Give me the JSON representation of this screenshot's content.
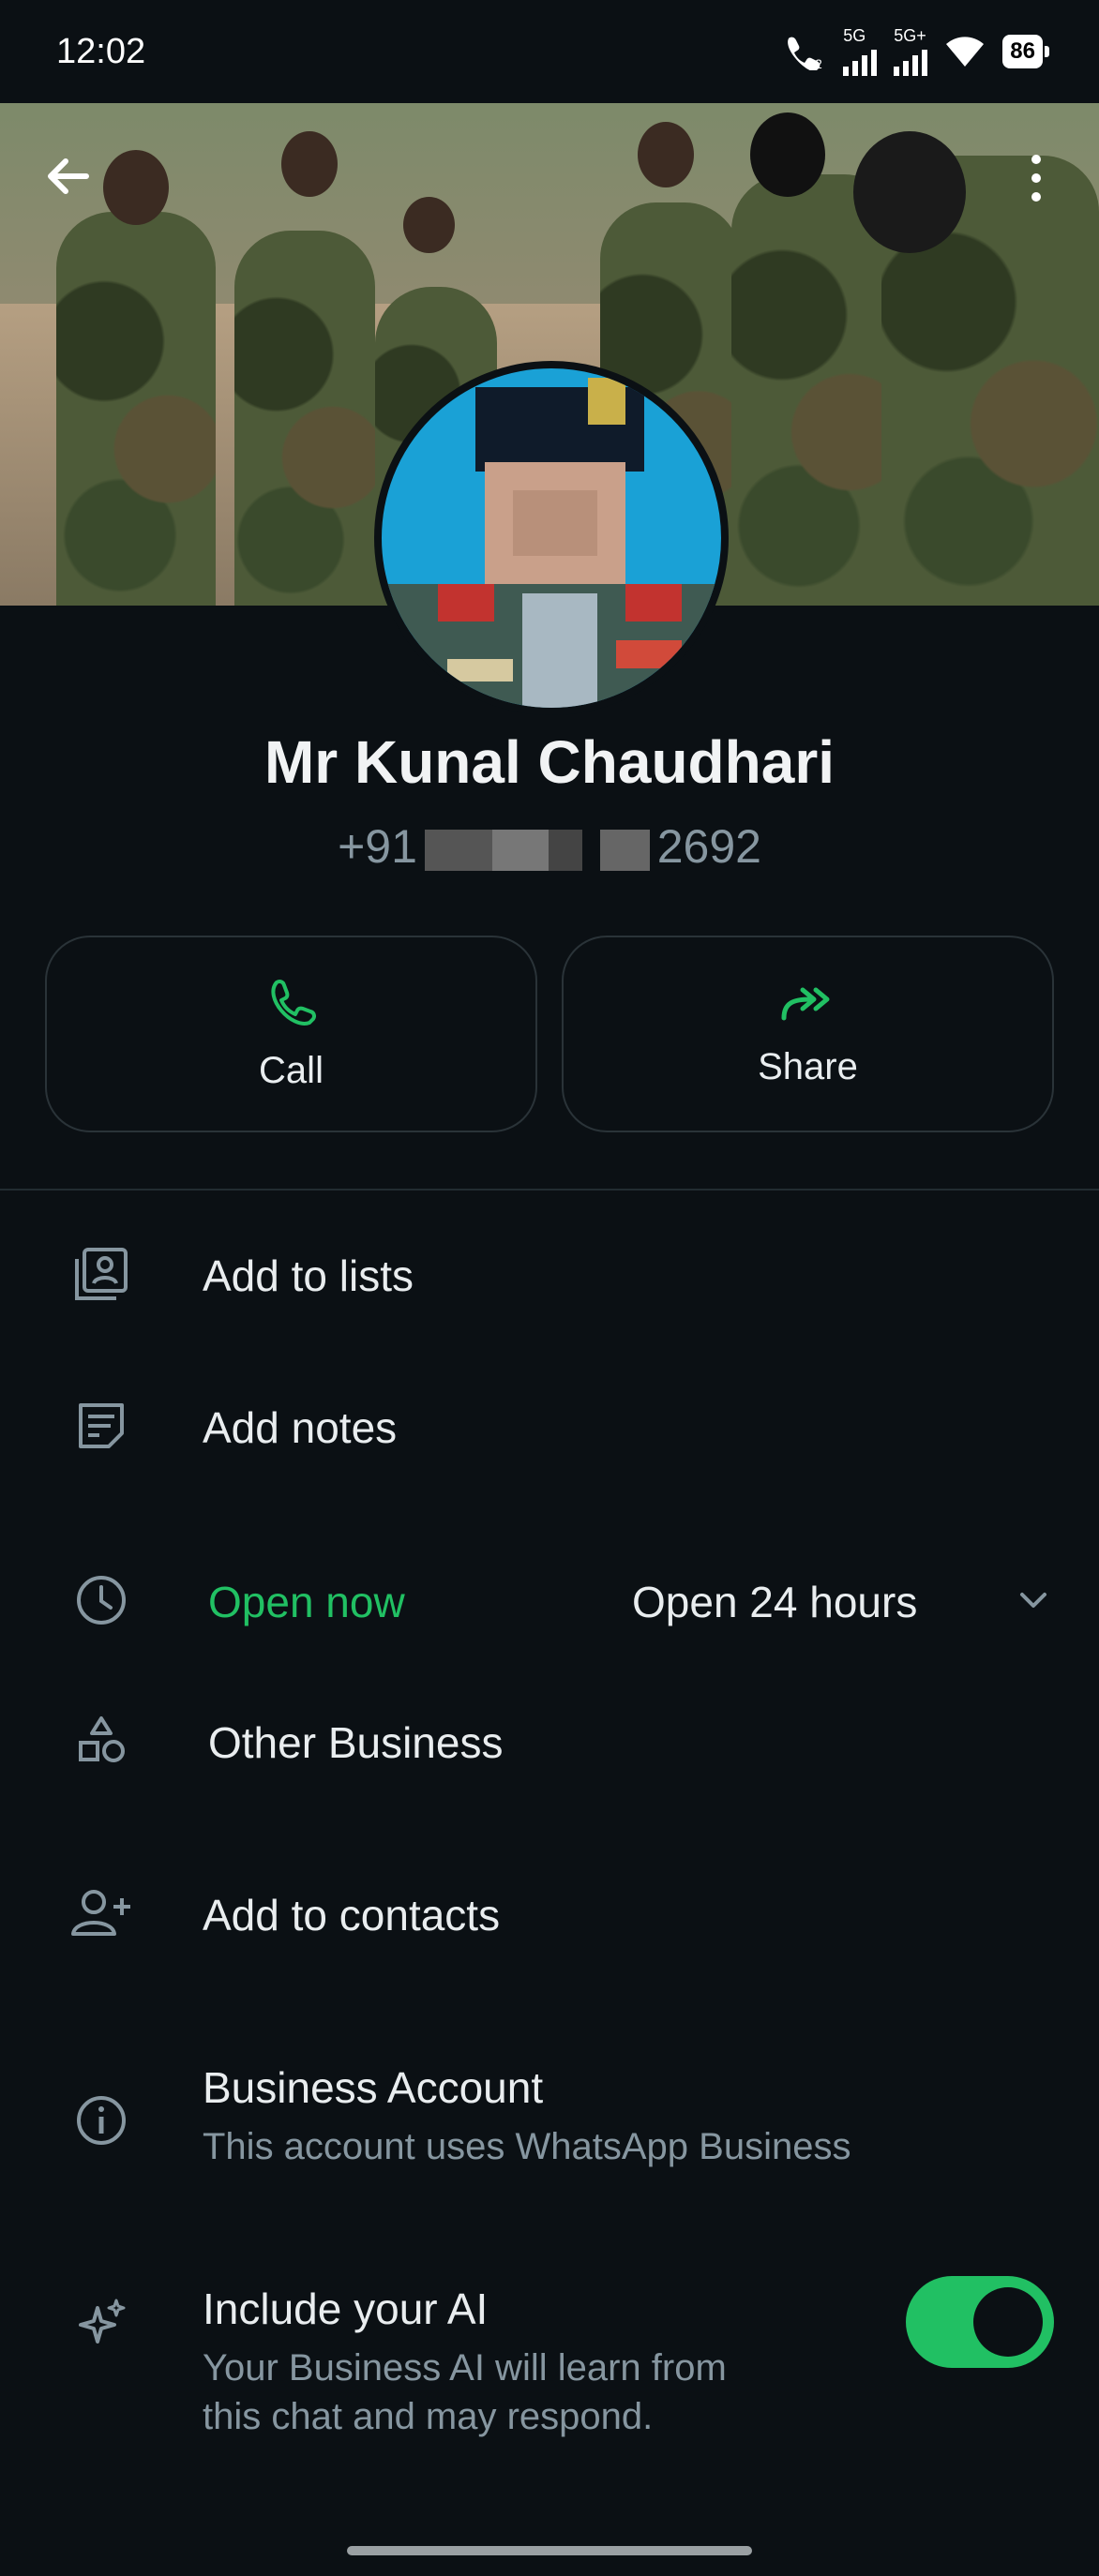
{
  "status_bar": {
    "time": "12:02",
    "battery": "86",
    "net1": "5G",
    "net2": "5G+"
  },
  "profile": {
    "name": "Mr Kunal Chaudhari",
    "phone_prefix": "+91",
    "phone_suffix": "2692"
  },
  "actions": [
    {
      "label": "Call",
      "icon": "phone-icon"
    },
    {
      "label": "Share",
      "icon": "share-arrow-icon"
    }
  ],
  "menu": {
    "add_to_lists": "Add to lists",
    "add_notes": "Add notes",
    "open_status": "Open now",
    "open_hours": "Open 24 hours",
    "category": "Other Business",
    "add_to_contacts": "Add to contacts",
    "business_title": "Business Account",
    "business_sub": "This account uses WhatsApp Business",
    "ai_title": "Include your AI",
    "ai_sub_1": "Your Business AI will learn from",
    "ai_sub_2": "this chat and may respond."
  },
  "toggles": {
    "include_ai": true
  },
  "colors": {
    "accent": "#21c063",
    "background": "#0b1014",
    "secondary_text": "#8696a0"
  }
}
